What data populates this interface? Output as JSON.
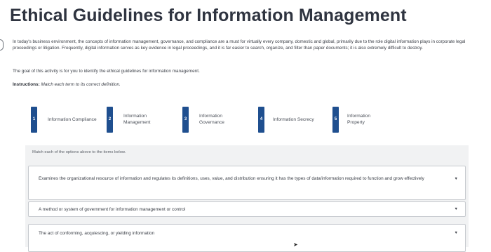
{
  "page": {
    "title": "Ethical Guidelines for Information Management",
    "intro": "In today's business environment, the concepts of information management, governance, and compliance are a must for virtually every company, domestic and global, primarily due to the role digital information plays in corporate legal proceedings or litigation. Frequently, digital information serves as key evidence in legal proceedings, and it is far easier to search, organize, and filter than paper documents; it is also extremely difficult to destroy.",
    "goal": "The goal of this activity is for you to identify the ethical guidelines for information management.",
    "instructions_label": "Instructions:",
    "instructions_text": "Match each term to its correct definition."
  },
  "terms": [
    {
      "number": "1",
      "label": "Information Compliance"
    },
    {
      "number": "2",
      "label": "Information Management"
    },
    {
      "number": "3",
      "label": "Information Governance"
    },
    {
      "number": "4",
      "label": "Information Secrecy"
    },
    {
      "number": "5",
      "label": "Information Property"
    }
  ],
  "matching": {
    "hint": "Match each of the options above to the items below.",
    "items": [
      {
        "text": "Examines the organizational resource of information and regulates its definitions, uses, value, and distribution ensuring it has the types of data/information required to function and grow effectively"
      },
      {
        "text": "A method or system of government for information management or control"
      },
      {
        "text": "The act of conforming, acquiescing, or yielding information"
      }
    ],
    "dropdown_icon": "caret-down-icon"
  },
  "colors": {
    "accent": "#1f4f8f",
    "panel_bg": "#f1f2f3"
  }
}
